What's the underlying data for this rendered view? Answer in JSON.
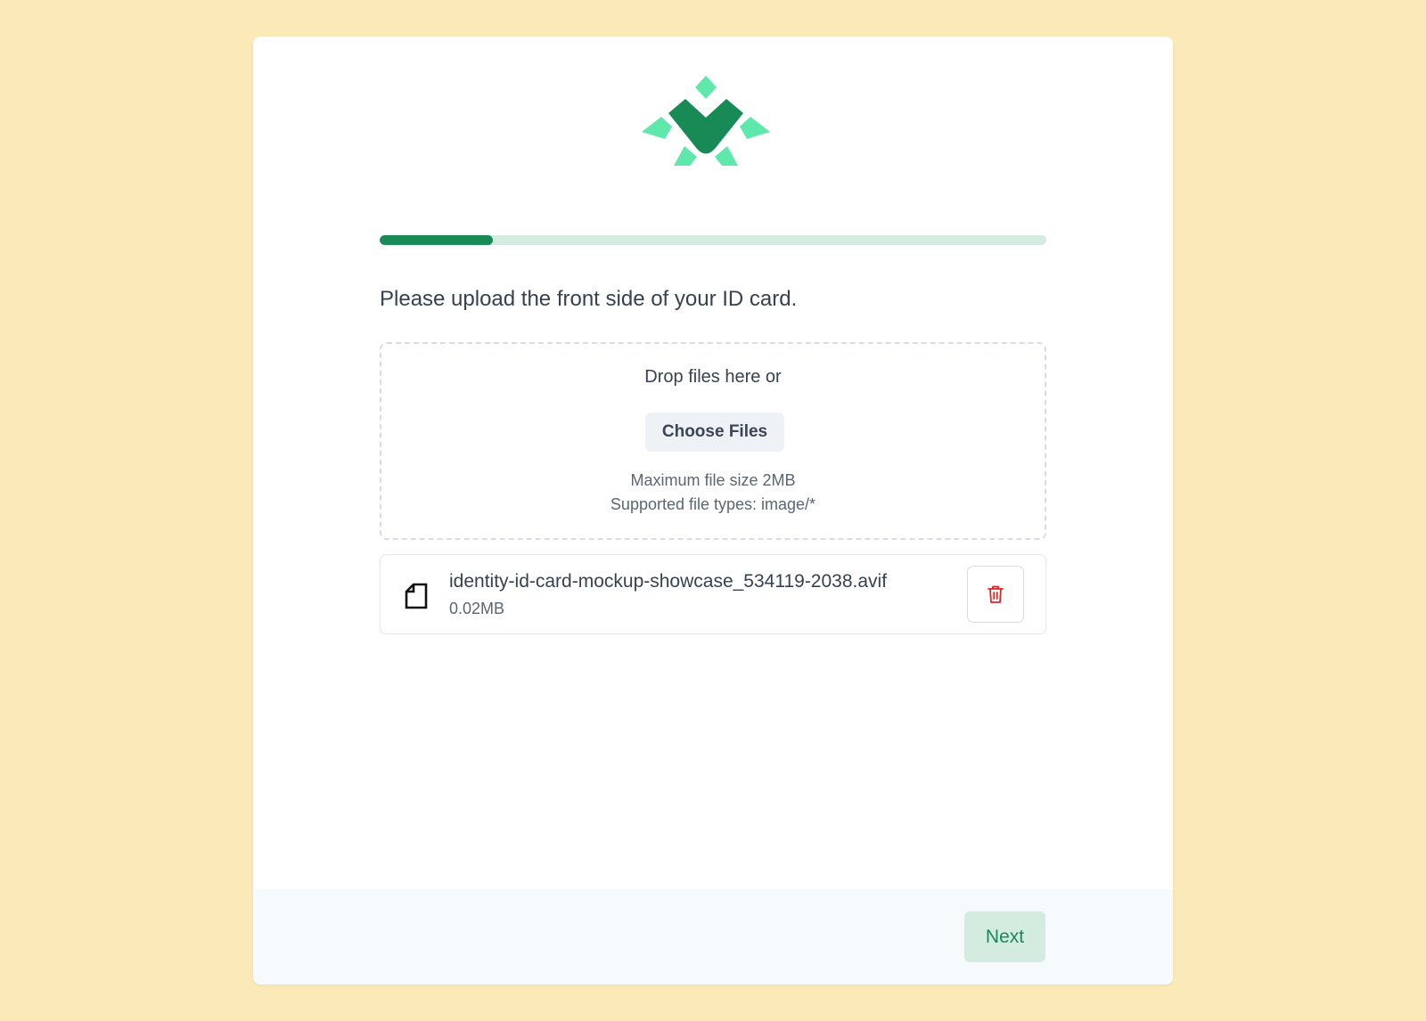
{
  "colors": {
    "page_background": "#fbe9b7",
    "brand_dark": "#178a56",
    "brand_light": "#5ee8ab",
    "delete_red": "#dc2626"
  },
  "logo": {
    "icon": "brand-logo-icon"
  },
  "progress": {
    "fraction": 0.17
  },
  "prompt": "Please upload the front side of your ID card.",
  "dropzone": {
    "drop_text": "Drop files here or",
    "choose_label": "Choose Files",
    "max_size": "Maximum file size 2MB",
    "types": "Supported file types: image/*"
  },
  "file": {
    "icon": "file-icon",
    "name": "identity-id-card-mockup-showcase_534119-2038.avif",
    "size": "0.02MB",
    "delete_icon": "trash-icon"
  },
  "footer": {
    "next_label": "Next"
  }
}
